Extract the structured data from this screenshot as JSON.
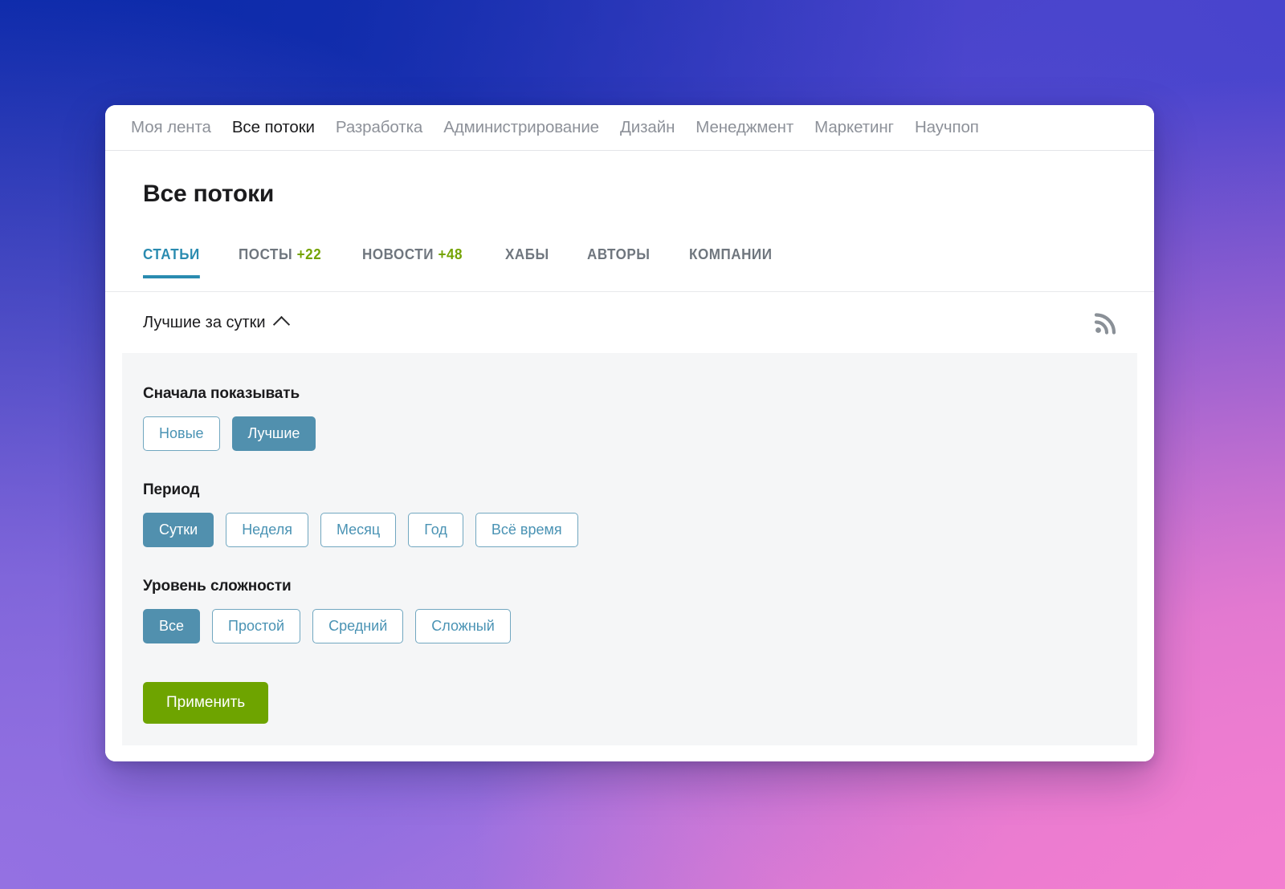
{
  "theme": {
    "accent_teal": "#2a8bb0",
    "chip_blue": "#4a93b4",
    "chip_selected_bg": "#5190ae",
    "badge_green": "#74a302",
    "apply_green": "#6ea400",
    "panel_bg": "#f5f6f7"
  },
  "topnav": {
    "items": [
      {
        "label": "Моя лента",
        "active": false
      },
      {
        "label": "Все потоки",
        "active": true
      },
      {
        "label": "Разработка",
        "active": false
      },
      {
        "label": "Администрирование",
        "active": false
      },
      {
        "label": "Дизайн",
        "active": false
      },
      {
        "label": "Менеджмент",
        "active": false
      },
      {
        "label": "Маркетинг",
        "active": false
      },
      {
        "label": "Научпоп",
        "active": false
      }
    ]
  },
  "page": {
    "title": "Все потоки"
  },
  "tabs": [
    {
      "label": "СТАТЬИ",
      "badge": "",
      "active": true
    },
    {
      "label": "ПОСТЫ",
      "badge": "+22",
      "active": false
    },
    {
      "label": "НОВОСТИ",
      "badge": "+48",
      "active": false
    },
    {
      "label": "ХАБЫ",
      "badge": "",
      "active": false
    },
    {
      "label": "АВТОРЫ",
      "badge": "",
      "active": false
    },
    {
      "label": "КОМПАНИИ",
      "badge": "",
      "active": false
    }
  ],
  "sort_row": {
    "label": "Лучшие за сутки",
    "chevron": "chevron-up-icon",
    "rss": "rss-icon"
  },
  "filters": {
    "groups": [
      {
        "title": "Сначала показывать",
        "name": "show-first",
        "options": [
          {
            "label": "Новые",
            "selected": false
          },
          {
            "label": "Лучшие",
            "selected": true
          }
        ]
      },
      {
        "title": "Период",
        "name": "period",
        "options": [
          {
            "label": "Сутки",
            "selected": true
          },
          {
            "label": "Неделя",
            "selected": false
          },
          {
            "label": "Месяц",
            "selected": false
          },
          {
            "label": "Год",
            "selected": false
          },
          {
            "label": "Всё время",
            "selected": false
          }
        ]
      },
      {
        "title": "Уровень сложности",
        "name": "difficulty",
        "options": [
          {
            "label": "Все",
            "selected": true
          },
          {
            "label": "Простой",
            "selected": false
          },
          {
            "label": "Средний",
            "selected": false
          },
          {
            "label": "Сложный",
            "selected": false
          }
        ]
      }
    ],
    "apply_label": "Применить"
  }
}
